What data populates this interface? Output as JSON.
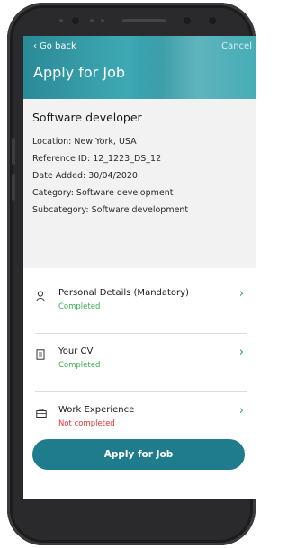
{
  "header": {
    "back_label": "Go back",
    "cancel_label": "Cancel",
    "title": "Apply for Job"
  },
  "job": {
    "title": "Software developer",
    "location": "Location: New York, USA",
    "reference": "Reference ID: 12_1223_DS_12",
    "date_added": "Date Added: 30/04/2020",
    "category": "Category: Software development",
    "subcategory": "Subcategory: Software development"
  },
  "sections": [
    {
      "title": "Personal Details (Mandatory)",
      "status": "Completed",
      "status_color": "#3aaa55",
      "icon": "person-icon"
    },
    {
      "title": "Your CV",
      "status": "Completed",
      "status_color": "#3aaa55",
      "icon": "document-icon"
    },
    {
      "title": "Work Experience",
      "status": "Not completed",
      "status_color": "#e0343a",
      "icon": "briefcase-icon"
    }
  ],
  "apply_button": "Apply for Job",
  "colors": {
    "accent": "#1e7c8d",
    "header": "#3ea9b4",
    "completed": "#3aaa55",
    "not_completed": "#e0343a"
  }
}
